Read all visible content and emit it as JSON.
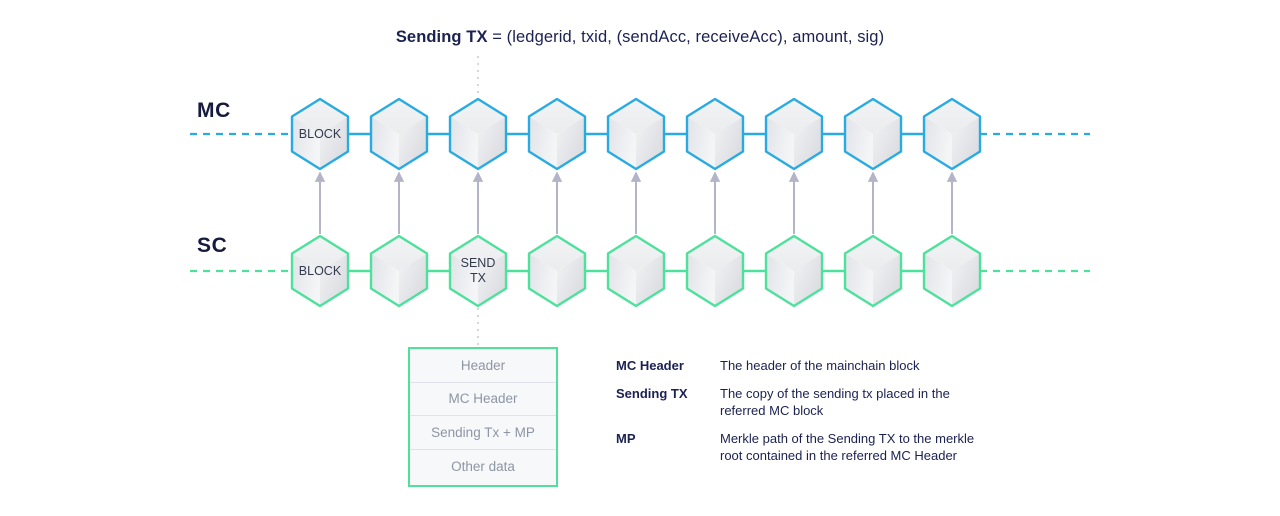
{
  "title": {
    "bold": "Sending TX",
    "rest": " = (ledgerid, txid, (sendAcc, receiveAcc), amount, sig)"
  },
  "colors": {
    "mainchain": "#29abe2",
    "sidechain": "#4de19c",
    "arrow": "#b3b4c8",
    "text_dark": "#1b2150",
    "block_label": "#333a4d",
    "struct_label": "#8e95a3",
    "struct_border": "#51e09a",
    "divider": "#dfe2e8"
  },
  "chains": [
    {
      "id": "mainchain",
      "label": "MC",
      "accent": "#29abe2",
      "blocks": [
        {
          "label": "BLOCK"
        },
        {
          "label": ""
        },
        {
          "label": ""
        },
        {
          "label": ""
        },
        {
          "label": ""
        },
        {
          "label": ""
        },
        {
          "label": ""
        },
        {
          "label": ""
        },
        {
          "label": ""
        }
      ]
    },
    {
      "id": "sidechain",
      "label": "SC",
      "accent": "#4de19c",
      "blocks": [
        {
          "label": "BLOCK"
        },
        {
          "label": ""
        },
        {
          "label": "SEND\nTX"
        },
        {
          "label": ""
        },
        {
          "label": ""
        },
        {
          "label": ""
        },
        {
          "label": ""
        },
        {
          "label": ""
        },
        {
          "label": ""
        }
      ]
    }
  ],
  "structure_box": {
    "rows": [
      {
        "label": "Header"
      },
      {
        "label": "MC Header"
      },
      {
        "label": "Sending Tx + MP"
      },
      {
        "label": "Other data"
      }
    ]
  },
  "legend": {
    "entries": [
      {
        "term": "MC Header",
        "description": "The header of the mainchain block"
      },
      {
        "term": "Sending TX",
        "description": "The copy of the sending tx placed in the\nreferred MC block"
      },
      {
        "term": "MP",
        "description": "Merkle path of the Sending TX to the merkle\nroot contained in the referred  MC Header"
      }
    ]
  }
}
